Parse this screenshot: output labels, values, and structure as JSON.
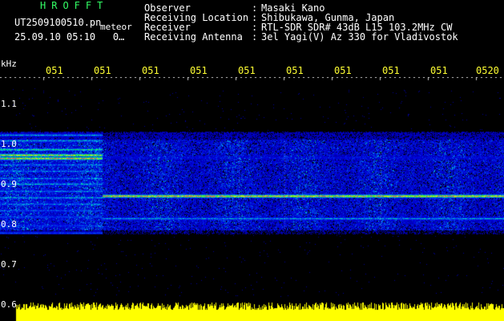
{
  "header": {
    "app_title": "HROFFT",
    "file_name": "UT2509100510.pn",
    "mode_label": "meteor",
    "date_line": "25.09.10 05:10   0…",
    "info": [
      {
        "label": "Observer",
        "sep": ":",
        "value": "Masaki Kano"
      },
      {
        "label": "Receiving Location",
        "sep": ":",
        "value": "Shibukawa, Gunma, Japan"
      },
      {
        "label": "Receiver",
        "sep": ":",
        "value": "RTL-SDR SDR# 43dB L15 103.2MHz CW"
      },
      {
        "label": "Receiving Antenna",
        "sep": ":",
        "value": "3el Yagi(V) Az 330 for Vladivostok"
      }
    ]
  },
  "axes": {
    "y_unit": "kHz",
    "x_ticks": [
      "051",
      "051",
      "051",
      "051",
      "051",
      "051",
      "051",
      "051",
      "051",
      "0520"
    ],
    "y_ticks": [
      "1.1",
      "1.0",
      "0.9",
      "0.8",
      "0.7",
      "0.6"
    ]
  },
  "colors": {
    "background": "#000000",
    "info_text": "#ffffff",
    "tick_text": "#ffff33",
    "title_text": "#33ff66",
    "signal_peak": "#ff3377",
    "noise_floor": "#0000c0",
    "audio_bar": "#ffff00"
  }
}
